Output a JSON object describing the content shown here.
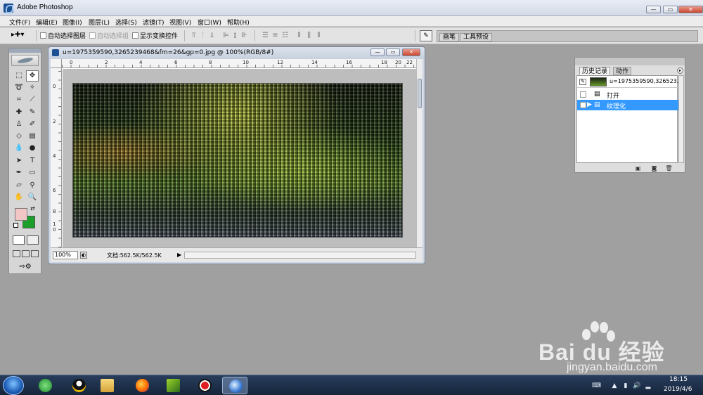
{
  "app": {
    "title": "Adobe Photoshop",
    "window_buttons": {
      "minimize": "—",
      "maximize": "▭",
      "close": "✕"
    }
  },
  "menubar": {
    "items": [
      "文件(F)",
      "编辑(E)",
      "图像(I)",
      "图层(L)",
      "选择(S)",
      "滤镜(T)",
      "视图(V)",
      "窗口(W)",
      "帮助(H)"
    ]
  },
  "options": {
    "tool_preset_glyph": "▸✚▾",
    "auto_select_layer": "自动选择图层",
    "auto_select_group": "自动选择组",
    "show_transform": "显示变换控件",
    "palette_well_tabs": [
      "画笔",
      "工具预设"
    ]
  },
  "document": {
    "title": "u=1975359590,3265239468&fm=26&gp=0.jpg @ 100%(RGB/8#)",
    "zoom": "100%",
    "doc_info": "文档:562.5K/562.5K",
    "ruler_top": [
      "0",
      "2",
      "4",
      "6",
      "8",
      "10",
      "12",
      "14",
      "16",
      "18",
      "20",
      "22"
    ],
    "ruler_left": [
      "0",
      "2",
      "4",
      "6",
      "8",
      "1\n0"
    ]
  },
  "history": {
    "tabs": [
      "历史记录",
      "动作"
    ],
    "snapshot_label": "u=1975359590,326523...",
    "items": [
      {
        "label": "打开",
        "selected": false
      },
      {
        "label": "纹理化",
        "selected": true
      }
    ]
  },
  "taskbar": {
    "time": "18:15",
    "date": "2019/4/6"
  },
  "watermark": {
    "brand": "Bai du 经验",
    "url": "jingyan.baidu.com"
  },
  "colors": {
    "foreground": "#f3c6c6",
    "background": "#1aa02a",
    "selection": "#3399ff"
  }
}
